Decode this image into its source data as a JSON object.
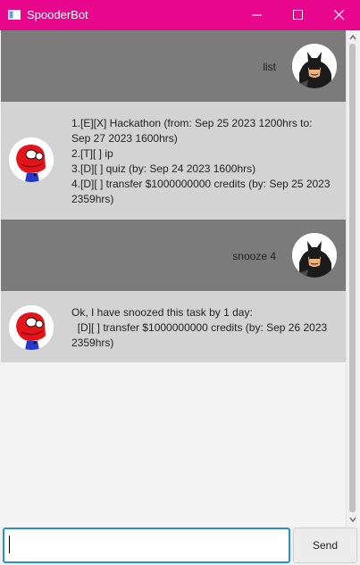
{
  "window": {
    "title": "SpooderBot"
  },
  "icons": {
    "app": "app-window-icon",
    "minimize": "minimize-icon",
    "maximize": "maximize-icon",
    "close": "close-icon",
    "user_avatar": "batman-avatar-icon",
    "bot_avatar": "spiderman-avatar-icon"
  },
  "colors": {
    "titlebar": "#e8078c",
    "user_bubble": "#7b7b7b",
    "bot_bubble": "#d3d3d3",
    "input_focus": "#2a8de0"
  },
  "messages": [
    {
      "sender": "user",
      "text": "list"
    },
    {
      "sender": "bot",
      "lines": [
        "1.[E][X] Hackathon (from: Sep 25 2023 1200hrs to: Sep 27 2023 1600hrs)",
        "2.[T][ ] ip",
        "3.[D][ ] quiz (by: Sep 24 2023 1600hrs)",
        "4.[D][ ] transfer $1000000000 credits (by: Sep 25 2023 2359hrs)"
      ]
    },
    {
      "sender": "user",
      "text": "snooze 4"
    },
    {
      "sender": "bot",
      "lines": [
        "Ok, I have snoozed this task by 1 day:",
        "  [D][ ] transfer $1000000000 credits (by: Sep 26 2023 2359hrs)"
      ]
    }
  ],
  "input": {
    "value": "",
    "placeholder": ""
  },
  "send_button": {
    "label": "Send"
  }
}
